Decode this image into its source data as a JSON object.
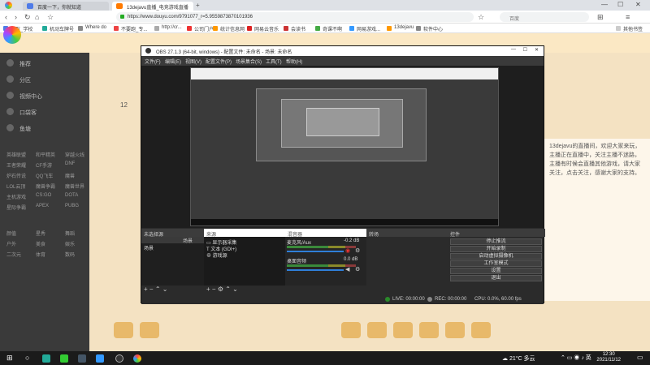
{
  "browser": {
    "tabs": [
      {
        "label": "百度一下，你就知道"
      },
      {
        "label": "13dejavu直播_电竞游戏直播"
      }
    ],
    "new_tab": "+",
    "url": "https://www.douyu.com/9791077_r=5.9559873870101936",
    "search_placeholder": "百度",
    "bookmarks": [
      "斯万_学校",
      "机动车牌号",
      "Where do",
      "不要跑_专...",
      "http://cr...",
      "公司门户",
      "统计信息网",
      "网易云音乐",
      "会读书",
      "奇课不啊",
      "网易游戏...",
      "13dejavu",
      "软件中心",
      "其他书签"
    ]
  },
  "site": {
    "sidebar_nav": [
      "推荐",
      "分区",
      "视频中心",
      "口袋客",
      "鱼塘"
    ],
    "categories": [
      [
        "英雄联盟",
        "和平精英",
        "穿越火线"
      ],
      [
        "王者荣耀",
        "CF手游",
        "DNF"
      ],
      [
        "炉石传说",
        "QQ飞车",
        "魔兽"
      ],
      [
        "LOL云顶",
        "魔兽争霸",
        "魔兽世界"
      ],
      [
        "主机游戏",
        "CS:GO",
        "DOTA"
      ],
      [
        "星际争霸",
        "APEX",
        "PUBG"
      ]
    ],
    "categories2": [
      [
        "颜值",
        "星秀",
        "舞蹈"
      ],
      [
        "户外",
        "美食",
        "娱乐"
      ],
      [
        "二次元",
        "体育",
        "数码"
      ]
    ],
    "viewer_count": "12",
    "right_text": "13dejavu的直播间，欢迎大家来玩，主播正在直播中，关注主播不迷路，主播有时候会直播其他游戏，请大家关注，点击关注，感谢大家的支持。"
  },
  "obs": {
    "title": "OBS 27.1.3 (64-bit, windows) - 配置文件: 未命名 - 场景: 未命名",
    "menu": [
      "文件(F)",
      "编辑(E)",
      "视图(V)",
      "配置文件(P)",
      "场景集合(S)",
      "工具(T)",
      "帮助(H)"
    ],
    "docks": {
      "scenes_header": "场景",
      "scenes_title": "未选择源",
      "scene_item": "场景",
      "sources_header": "来源",
      "sources": [
        "显示器采集",
        "文本 (GDI+)",
        "游戏源"
      ],
      "mixer_header": "混音器",
      "mixer": [
        {
          "name": "麦克风/Aux",
          "db": "-0.2 dB"
        },
        {
          "name": "桌面音频",
          "db": "0.0 dB"
        }
      ],
      "transitions_header": "转场",
      "controls_header": "控件",
      "controls": [
        "停止推流",
        "开始录制",
        "启动虚拟摄像机",
        "工作室模式",
        "设置",
        "退出"
      ]
    },
    "status": {
      "live": "LIVE: 00:00:00",
      "rec": "REC: 00:00:00",
      "cpu": "CPU: 0.0%, 60.00 fps"
    }
  },
  "taskbar": {
    "weather": "21°C 多云",
    "time": "12:30",
    "date": "2021/11/12"
  }
}
